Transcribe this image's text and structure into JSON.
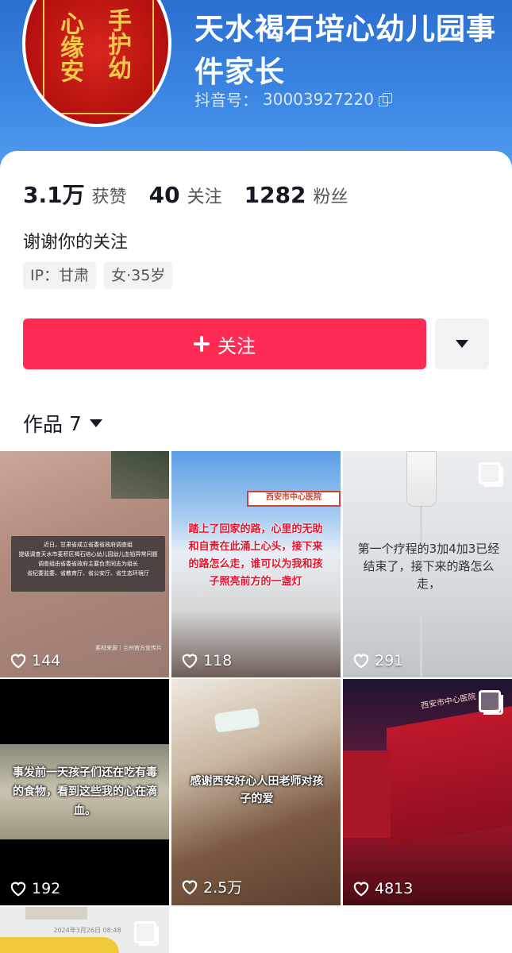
{
  "profile": {
    "name": "天水褐石培心幼儿园事件家长",
    "douyin_id_label": "抖音号：",
    "douyin_id": "30003927220",
    "avatar_text_1": "心缘安",
    "avatar_text_2": "手护幼"
  },
  "stats": [
    {
      "num": "3.1万",
      "label": "获赞"
    },
    {
      "num": "40",
      "label": "关注"
    },
    {
      "num": "1282",
      "label": "粉丝"
    }
  ],
  "bio": "谢谢你的关注",
  "tags": [
    "IP：甘肃",
    "女·35岁"
  ],
  "actions": {
    "follow": "关注"
  },
  "works": {
    "label": "作品",
    "count": "7"
  },
  "videos": [
    {
      "likes": "144",
      "caption": "近日，甘肃省成立省委省政府调查组\n提级调查天水市麦积区褐石培心幼儿园幼儿血铅异常问题\n调查组由省委省政府主要负责同志为组长\n省纪委监委、省教育厅、省公安厅、省生态环境厅",
      "footer": "素材来源｜兰州官方宣传片"
    },
    {
      "likes": "118",
      "caption": "踏上了回家的路，心里的无助和自责在此涌上心头，接下来的路怎么走，谁可以为我和孩子照亮前方的一盏灯",
      "sign": "西安市中心医院"
    },
    {
      "likes": "291",
      "caption": "第一个疗程的3加4加3已经结束了，接下来的路怎么走，"
    },
    {
      "likes": "192",
      "caption": "事发前一天孩子们还在吃有毒的食物，看到这些我的心在滴血。"
    },
    {
      "likes": "2.5万",
      "caption": "感谢西安好心人田老师对孩子的爱"
    },
    {
      "likes": "4813",
      "sign": "西安市中心医院"
    },
    {
      "date": "2024年3月26日 08:48"
    }
  ]
}
